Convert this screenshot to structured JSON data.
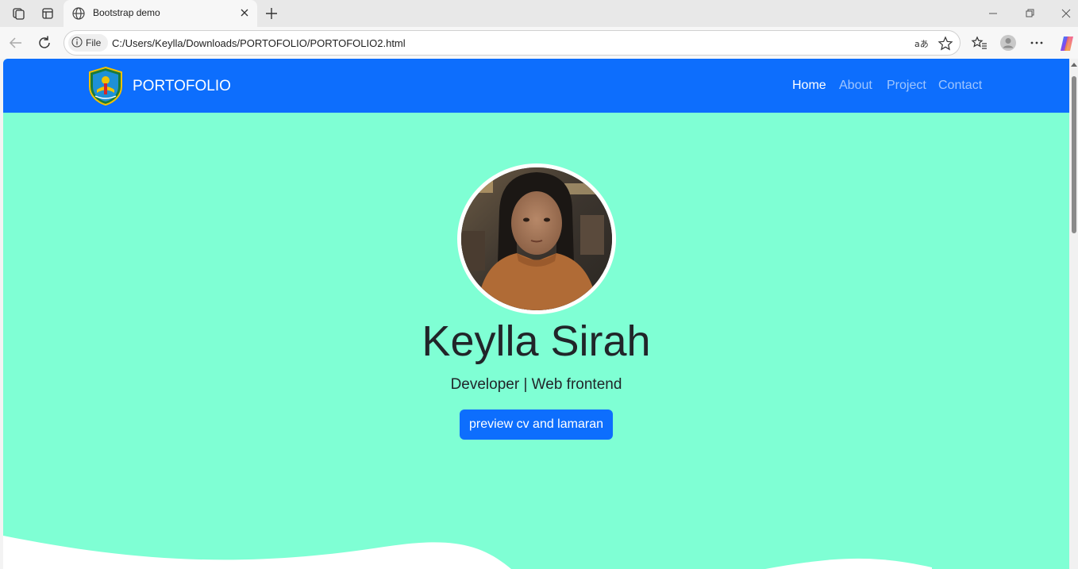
{
  "browser": {
    "tab_title": "Bootstrap demo",
    "address_chip": "File",
    "url": "C:/Users/Keylla/Downloads/PORTOFOLIO/PORTOFOLIO2.html"
  },
  "page": {
    "brand": "PORTOFOLIO",
    "nav": [
      {
        "label": "Home",
        "active": true
      },
      {
        "label": "About",
        "active": false
      },
      {
        "label": "Project",
        "active": false
      },
      {
        "label": "Contact",
        "active": false
      }
    ],
    "name": "Keylla Sirah",
    "subtitle": "Developer | Web frontend",
    "cta_label": "preview cv and lamaran"
  },
  "colors": {
    "navbar": "#0d6efd",
    "hero_bg": "#7fffd4",
    "button": "#0d6efd",
    "text": "#212529"
  },
  "icons": [
    "workspaces-icon",
    "tab-actions-icon",
    "globe-icon",
    "close-icon",
    "plus-icon",
    "minimize-icon",
    "restore-icon",
    "back-icon",
    "reload-icon",
    "info-icon",
    "read-aloud-icon",
    "star-icon",
    "favorites-icon",
    "profile-icon",
    "more-icon",
    "copilot-icon",
    "school-logo"
  ]
}
